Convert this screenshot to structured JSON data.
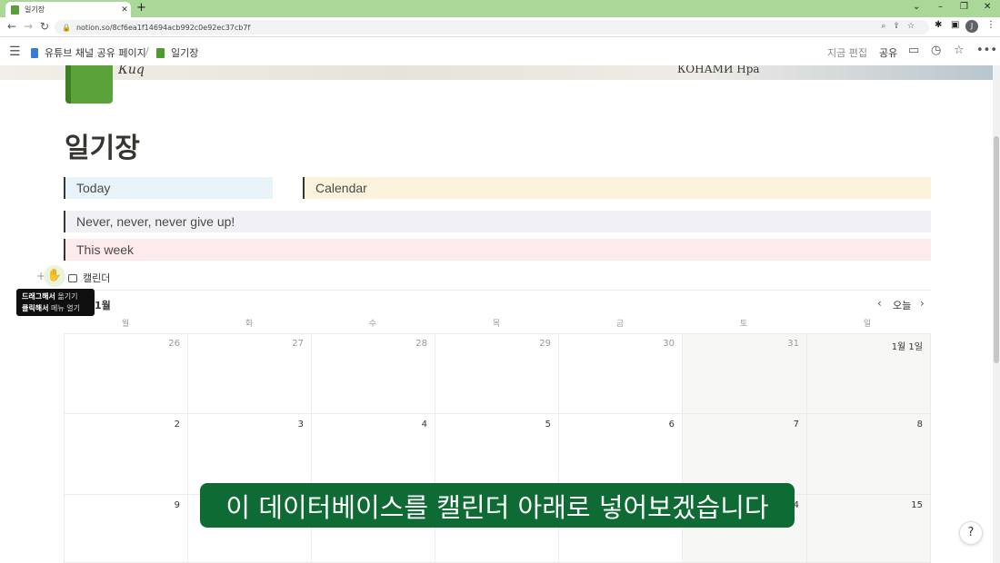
{
  "browser": {
    "tab_title": "일기장",
    "close_glyph": "✕",
    "new_tab_glyph": "+",
    "url": "notion.so/8cf6ea1f14694acb992c0e92ec37cb7f",
    "avatar_initial": "J",
    "window_controls": [
      "⌄",
      "–",
      "❐",
      "✕"
    ]
  },
  "topbar": {
    "breadcrumb_parent": "유튜브 채널 공유 페이지",
    "breadcrumb_sep": "/",
    "breadcrumb_current": "일기장",
    "edit_label": "지금 편집",
    "share_label": "공유"
  },
  "cover": {
    "text_left": "Киq",
    "text_right": "КОНАМИ  Нра"
  },
  "page": {
    "title": "일기장"
  },
  "blocks": {
    "today": "Today",
    "calendar": "Calendar",
    "never": "Never, never, never give up!",
    "this_week": "This week"
  },
  "database": {
    "title": "캘린더",
    "tooltip_line1_bold": "드래그해서",
    "tooltip_line1_rest": " 옮기기",
    "tooltip_line2_bold": "클릭해서",
    "tooltip_line2_rest": " 메뉴 열기",
    "month_label": "1월",
    "today_label": "오늘",
    "weekdays": [
      "월",
      "화",
      "수",
      "목",
      "금",
      "토",
      "일"
    ],
    "weeks": [
      [
        "26",
        "27",
        "28",
        "29",
        "30",
        "31",
        "1월 1일"
      ],
      [
        "2",
        "3",
        "4",
        "5",
        "6",
        "7",
        "8"
      ],
      [
        "9",
        "",
        "",
        "",
        "",
        "14",
        "15"
      ]
    ]
  },
  "subtitle": "이 데이터베이스를 캘린더 아래로 넣어보겠습니다",
  "help_label": "?"
}
